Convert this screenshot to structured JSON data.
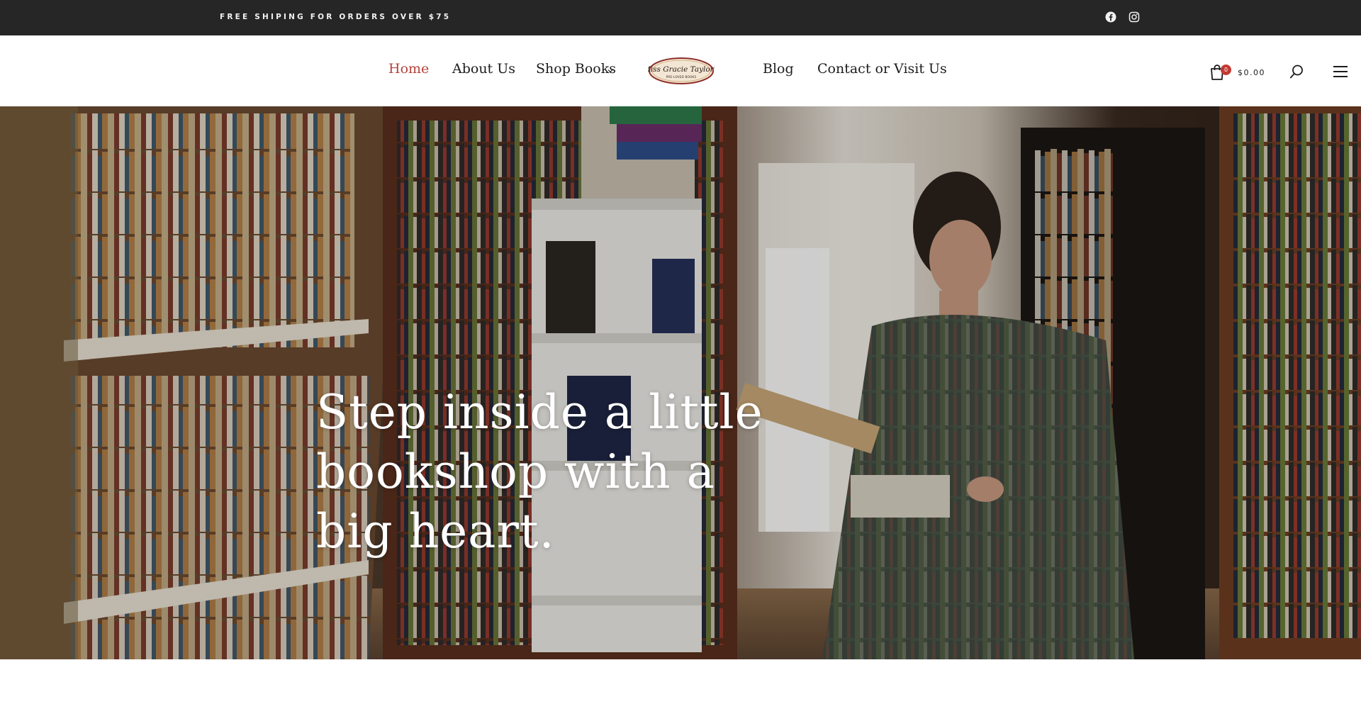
{
  "topbar": {
    "shipping_text": "FREE SHIPING FOR ORDERS OVER $75",
    "social": [
      {
        "icon": "facebook-icon"
      },
      {
        "icon": "instagram-icon"
      }
    ]
  },
  "nav": {
    "home": "Home",
    "about": "About Us",
    "shop": "Shop Books",
    "blog": "Blog",
    "contact": "Contact or Visit Us"
  },
  "logo": {
    "line1": "Miss Gracie Taylor's",
    "line2": "PRE-LOVED BOOKS"
  },
  "cart": {
    "count": "0",
    "total": "$0.00"
  },
  "icons": {
    "cart": "shopping-bag-icon",
    "search": "search-icon",
    "menu": "hamburger-menu-icon"
  },
  "hero": {
    "heading": "Step inside a little bookshop with a big heart."
  },
  "colors": {
    "topbar_bg": "#262626",
    "accent": "#b5443d",
    "badge": "#c23a32"
  }
}
